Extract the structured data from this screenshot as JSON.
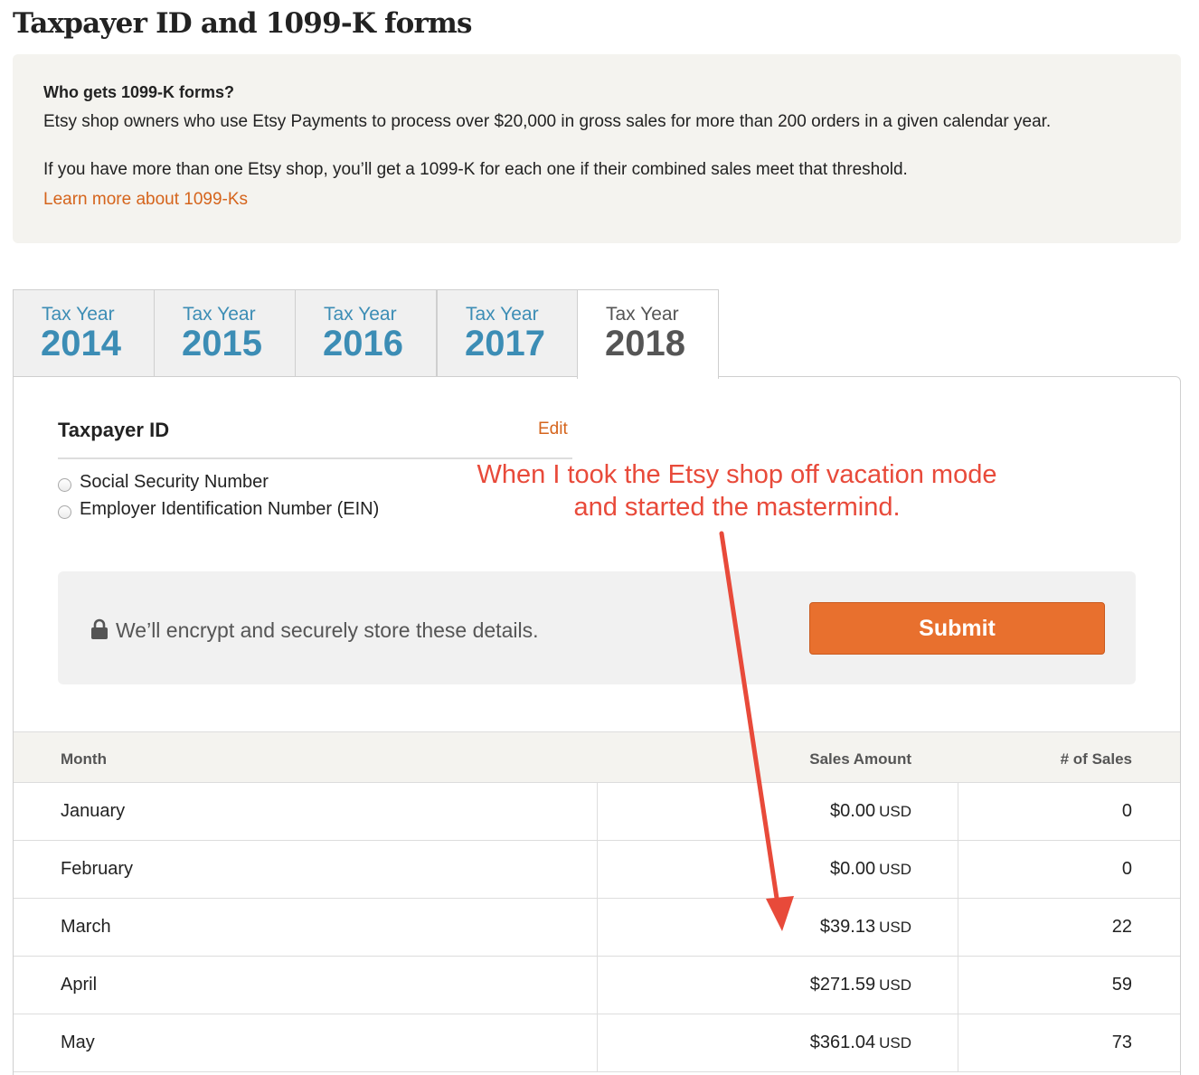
{
  "page": {
    "title": "Taxpayer ID and 1099-K forms"
  },
  "info": {
    "heading": "Who gets 1099-K forms?",
    "paragraph1": "Etsy shop owners who use Etsy Payments to process over $20,000 in gross sales for more than 200 orders in a given calendar year.",
    "paragraph2": "If you have more than one Etsy shop, you’ll get a 1099-K for each one if their combined sales meet that threshold.",
    "link": "Learn more about 1099-Ks"
  },
  "tabs": [
    {
      "label": "Tax Year",
      "year": "2014",
      "active": false
    },
    {
      "label": "Tax Year",
      "year": "2015",
      "active": false
    },
    {
      "label": "Tax Year",
      "year": "2016",
      "active": false
    },
    {
      "label": "Tax Year",
      "year": "2017",
      "active": false
    },
    {
      "label": "Tax Year",
      "year": "2018",
      "active": true
    }
  ],
  "taxpayer": {
    "title": "Taxpayer ID",
    "edit": "Edit",
    "options": [
      "Social Security Number",
      "Employer Identification Number (EIN)"
    ]
  },
  "annotation": {
    "line1": "When I took the Etsy shop off vacation mode",
    "line2": "and started the mastermind.",
    "color": "#e84a3a"
  },
  "secure": {
    "icon": "lock-icon",
    "text": "We’ll encrypt and securely store these details.",
    "submit": "Submit"
  },
  "table": {
    "headers": {
      "month": "Month",
      "sales": "Sales Amount",
      "count": "# of Sales"
    },
    "currency": "USD",
    "rows": [
      {
        "month": "January",
        "amount": "$0.00",
        "count": "0"
      },
      {
        "month": "February",
        "amount": "$0.00",
        "count": "0"
      },
      {
        "month": "March",
        "amount": "$39.13",
        "count": "22"
      },
      {
        "month": "April",
        "amount": "$271.59",
        "count": "59"
      },
      {
        "month": "May",
        "amount": "$361.04",
        "count": "73"
      }
    ]
  },
  "colors": {
    "accent": "#e8702e",
    "link": "#d5641c",
    "tab": "#3c8db5"
  }
}
